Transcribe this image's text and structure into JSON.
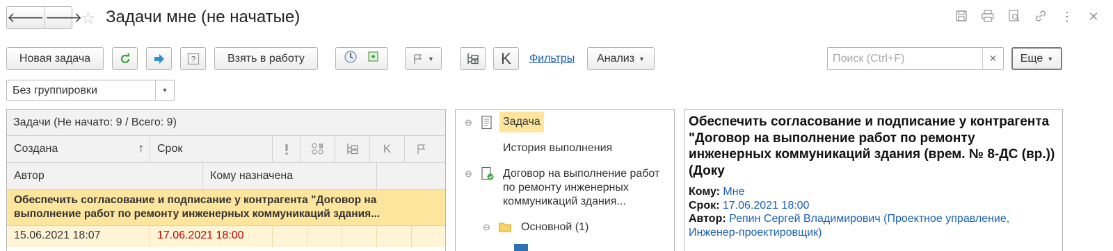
{
  "window": {
    "title": "Задачи мне (не начатые)"
  },
  "nav": {
    "back": "🡐",
    "forward": "🡒"
  },
  "toolbar": {
    "new_task": "Новая задача",
    "take_to_work": "Взять в работу",
    "k_label": "K",
    "filters": "Фильтры",
    "analysis": "Анализ",
    "more": "Еще",
    "search_placeholder": "Поиск (Ctrl+F)"
  },
  "grouping": {
    "value": "Без группировки"
  },
  "table": {
    "caption": "Задачи (Не начато: 9 / Всего: 9)",
    "col_created": "Создана",
    "col_due": "Срок",
    "col_author": "Автор",
    "col_assignee": "Кому назначена",
    "col_k": "K",
    "selected_title": "Обеспечить согласование и подписание у контрагента \"Договор на выполнение работ по ремонту инженерных коммуникаций здания...",
    "row_created": "15.06.2021 18:07",
    "row_due": "17.06.2021 18:00"
  },
  "tree": {
    "task": "Задача",
    "history": "История выполнения",
    "contract": "Договор на выполнение работ по ремонту инженерных коммуникаций здания...",
    "main_folder": "Основной (1)"
  },
  "details": {
    "title": "Обеспечить согласование и подписание у контрагента \"Договор  на  выполнение работ по ремонту инженерных коммуникаций здания (врем. № 8-ДС (вр.)) (Доку",
    "to_label": "Кому:",
    "to_value": "Мне",
    "due_label": "Срок:",
    "due_value": "17.06.2021 18:00",
    "author_label": "Автор:",
    "author_value": "Репин Сергей Владимирович (Проектное управление, Инженер-проектировщик)"
  },
  "colors": {
    "accent_link": "#1a5fb4",
    "selection": "#fde59d",
    "overdue": "#c00000",
    "refresh": "#3aa33a",
    "forward_arrow": "#2f8fd6"
  }
}
